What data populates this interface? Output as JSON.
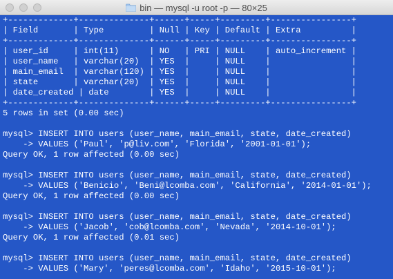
{
  "window": {
    "title": "bin — mysql -u root -p — 80×25"
  },
  "terminal": {
    "lines": [
      "+-------------+--------------+------+-----+---------+----------------+",
      "| Field       | Type         | Null | Key | Default | Extra          |",
      "+-------------+--------------+------+-----+---------+----------------+",
      "| user_id     | int(11)      | NO   | PRI | NULL    | auto_increment |",
      "| user_name   | varchar(20)  | YES  |     | NULL    |                |",
      "| main_email  | varchar(120) | YES  |     | NULL    |                |",
      "| state       | varchar(20)  | YES  |     | NULL    |                |",
      "| date_created | date        | YES  |     | NULL    |                |",
      "+-------------+--------------+------+-----+---------+----------------+",
      "5 rows in set (0.00 sec)",
      "",
      "mysql> INSERT INTO users (user_name, main_email, state, date_created)",
      "    -> VALUES ('Paul', 'p@liv.com', 'Florida', '2001-01-01');",
      "Query OK, 1 row affected (0.00 sec)",
      "",
      "mysql> INSERT INTO users (user_name, main_email, state, date_created)",
      "    -> VALUES ('Benicio', 'Beni@lcomba.com', 'California', '2014-01-01');",
      "Query OK, 1 row affected (0.00 sec)",
      "",
      "mysql> INSERT INTO users (user_name, main_email, state, date_created)",
      "    -> VALUES ('Jacob', 'cob@lcomba.com', 'Nevada', '2014-10-01');",
      "Query OK, 1 row affected (0.01 sec)",
      "",
      "mysql> INSERT INTO users (user_name, main_email, state, date_created)",
      "    -> VALUES ('Mary', 'peres@lcomba.com', 'Idaho', '2015-10-01');"
    ]
  },
  "colors": {
    "terminal_background": "#2557c7",
    "terminal_text": "#ffffff"
  }
}
